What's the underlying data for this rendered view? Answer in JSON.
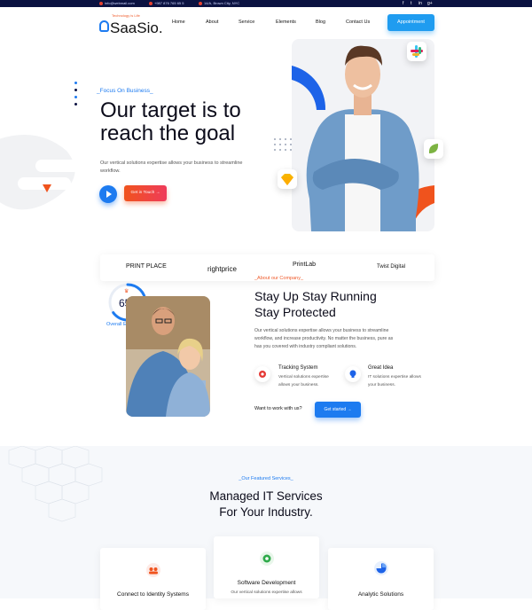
{
  "topbar": {
    "email": "info@webmail.com",
    "phone": "+987 876 765 65 5",
    "address": "14/A, Brown City, NYC",
    "social_icons": [
      "facebook-icon",
      "twitter-icon",
      "linkedin-icon",
      "google-plus-icon"
    ]
  },
  "logo": {
    "tagline": "Technology is Life",
    "name": "SaaSio."
  },
  "nav": {
    "items": [
      "Home",
      "About",
      "Service",
      "Elements",
      "Blog",
      "Contact Us"
    ],
    "cta": "Appointment"
  },
  "hero": {
    "eyebrow": "_Focus On Business_",
    "title_line1": "Our target is to",
    "title_line2": "reach the goal",
    "lead_line1": "Our vertical solutions expertise allows your business to streamline",
    "lead_line2": "workflow.",
    "cta": "Get in Touch →",
    "floating_icons": [
      "slack-icon",
      "sketch-icon",
      "leaf-icon"
    ]
  },
  "brands": [
    "PRINT PLACE",
    "rightprice",
    "PrintLab",
    "Twist Digital"
  ],
  "about": {
    "experience_percent": "65%",
    "experience_label": "Overall Experiences",
    "tag": "_About our Company_",
    "title_line1": "Stay Up Stay Running",
    "title_line2": "Stay Protected",
    "text_line1": "Our vertical solutions expertise allows your business to streamline",
    "text_line2": "workflow, and increase productivity. No matter the business, pure as",
    "text_line3": "has you covered with industry compliant solutions.",
    "features": [
      {
        "title": "Tracking System",
        "line1": "Vertical solutions expertise",
        "line2": "allows your business.",
        "icon": "gear-icon"
      },
      {
        "title": "Great Idea",
        "line1": "IT solutions expertise allows",
        "line2": "your business.",
        "icon": "lightbulb-icon"
      }
    ],
    "question": "Want to work with us?",
    "cta": "Get started →"
  },
  "services": {
    "tag": "_Our Featured Services_",
    "title_line1": "Managed IT Services",
    "title_line2": "For Your Industry.",
    "cards": [
      {
        "title": "Connect to Identity Systems",
        "text": "",
        "icon": "users-icon"
      },
      {
        "title": "Software Development",
        "text": "Our vertical solutions expertise allows",
        "icon": "cog-icon"
      },
      {
        "title": "Analytic Solutions",
        "text": "",
        "icon": "pie-chart-icon"
      }
    ]
  },
  "colors": {
    "primary": "#1d7bf0",
    "accent": "#f0531d",
    "dark": "#0b1241"
  }
}
